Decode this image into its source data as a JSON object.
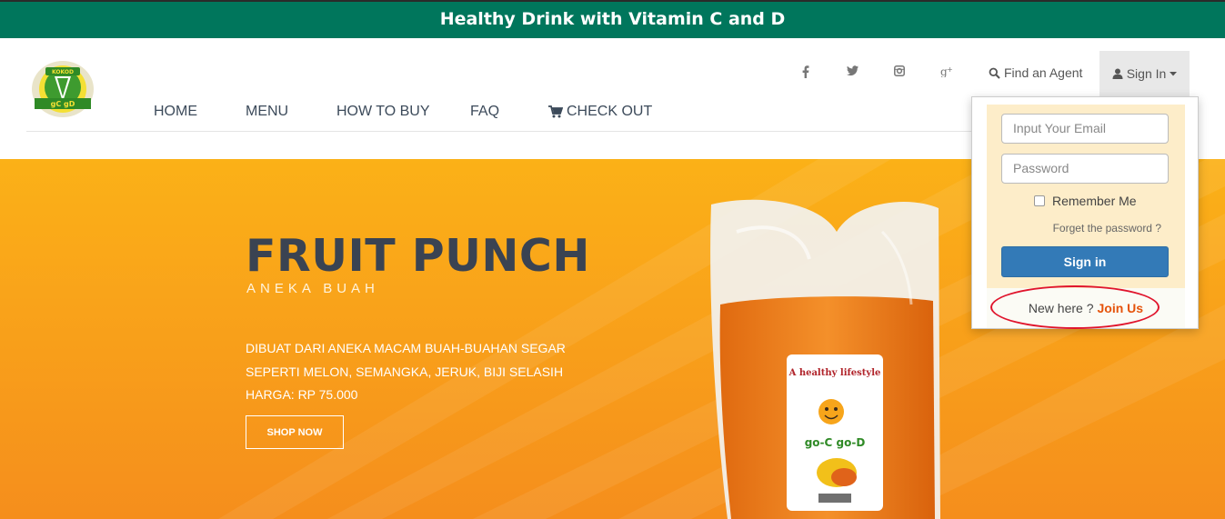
{
  "banner": {
    "text": "Healthy Drink with Vitamin C and D"
  },
  "logo": {
    "name": "Healthy Drink Logo"
  },
  "nav": {
    "home": "HOME",
    "menu": "MENU",
    "how_to_buy": "HOW TO BUY",
    "faq": "FAQ",
    "checkout": "CHECK OUT"
  },
  "social": [
    "facebook-icon",
    "twitter-icon",
    "instagram-icon",
    "google-plus-icon"
  ],
  "top_links": {
    "find_agent": "Find an Agent",
    "sign_in": "Sign In"
  },
  "hero": {
    "title": "FRUIT PUNCH",
    "subtitle": "ANEKA BUAH",
    "desc_line1": "DIBUAT DARI ANEKA MACAM BUAH-BUAHAN SEGAR",
    "desc_line2": "SEPERTI MELON, SEMANGKA, JERUK, BIJI SELASIH",
    "desc_line3": "HARGA: RP 75.000",
    "shop_button": "SHOP NOW",
    "label_arc": "A healthy lifestyle",
    "label_brand": "go-C go-D"
  },
  "login": {
    "email_placeholder": "Input Your Email",
    "password_placeholder": "Password",
    "remember": "Remember Me",
    "forget": "Forget the password ?",
    "sign_in_button": "Sign in",
    "new_here": "New here ?",
    "join_us": "Join Us"
  },
  "colors": {
    "banner": "#00765c",
    "hero": "#f9a31a",
    "primary_button": "#337ab7",
    "join": "#e5530b",
    "highlight": "#e0142c"
  }
}
